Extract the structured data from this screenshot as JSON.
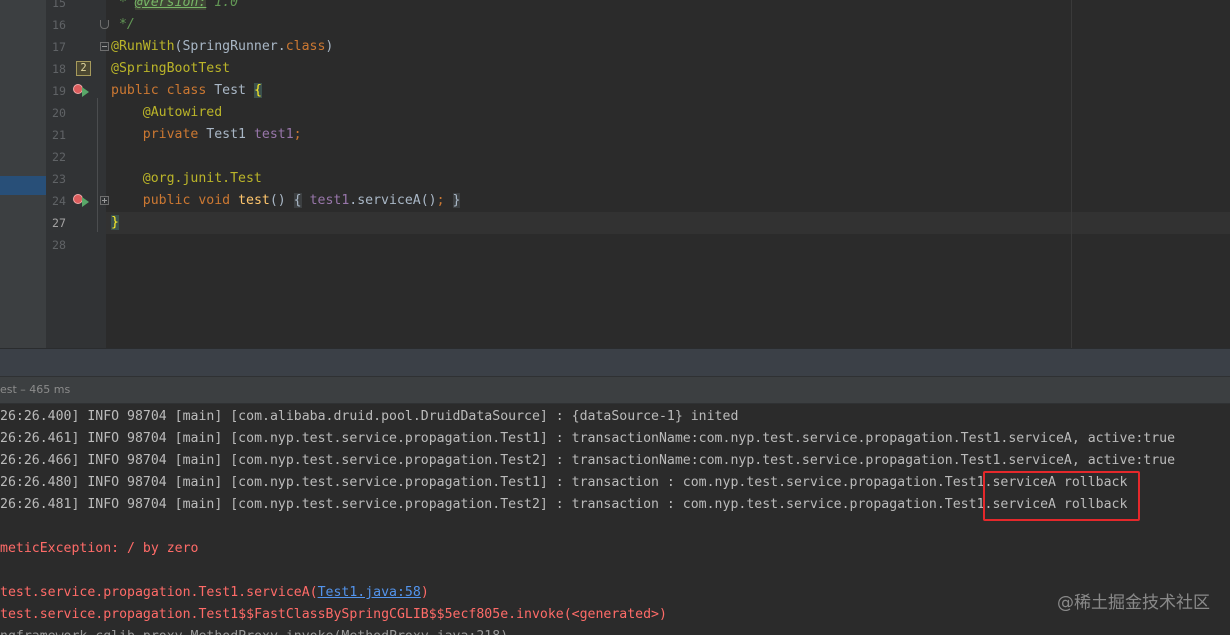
{
  "colors": {
    "editor_bg": "#2b2b2b",
    "keyword": "#cc7832",
    "annotation": "#bbb529",
    "field": "#9876aa",
    "method": "#ffc66d",
    "javadoc": "#629755",
    "console_text": "#bbbbbb",
    "error_text": "#ff6b68",
    "link": "#5394ec",
    "highlight_box": "#e5282b"
  },
  "editor": {
    "line_numbers": [
      "15",
      "16",
      "17",
      "18",
      "19",
      "20",
      "21",
      "22",
      "23",
      "24",
      "27",
      "28"
    ],
    "bookmark_mnemonic": "2",
    "code": {
      "line15": {
        "star": "*",
        "tag": "@version:",
        "value": "1.0"
      },
      "line16": {
        "end": "*/"
      },
      "line17": {
        "annotation": "@RunWith",
        "args": "(SpringRunner.",
        "keyword": "class",
        "close": ")"
      },
      "line18": {
        "annotation": "@SpringBootTest"
      },
      "line19": {
        "keyword": "public class",
        "name": "Test",
        "brace": "{"
      },
      "line20": {
        "annotation": "@Autowired"
      },
      "line21": {
        "keyword": "private",
        "type": "Test1",
        "field": "test1",
        "semi": ";"
      },
      "line23": {
        "annotation": "@org.junit.Test"
      },
      "line24": {
        "keyword": "public void",
        "method": "test",
        "parens": "()",
        "fold_open": "{",
        "field": "test1",
        "call": ".serviceA()",
        "semi": ";",
        "fold_close": "}"
      },
      "line27": {
        "brace": "}"
      }
    }
  },
  "run_panel": {
    "test_label": "est – 465 ms",
    "console": {
      "info_lines": [
        "26:26.400] INFO 98704 [main] [com.alibaba.druid.pool.DruidDataSource] : {dataSource-1} inited",
        "26:26.461] INFO 98704 [main] [com.nyp.test.service.propagation.Test1] : transactionName:com.nyp.test.service.propagation.Test1.serviceA, active:true",
        "26:26.466] INFO 98704 [main] [com.nyp.test.service.propagation.Test2] : transactionName:com.nyp.test.service.propagation.Test1.serviceA, active:true",
        "26:26.480] INFO 98704 [main] [com.nyp.test.service.propagation.Test1] : transaction : com.nyp.test.service.propagation.Test1.serviceA rollback",
        "26:26.481] INFO 98704 [main] [com.nyp.test.service.propagation.Test2] : transaction : com.nyp.test.service.propagation.Test1.serviceA rollback"
      ],
      "exception": "meticException: / by zero",
      "stack_1": {
        "prefix": "test.service.propagation.Test1.serviceA(",
        "link": "Test1.java:58",
        "suffix": ")"
      },
      "stack_2": "test.service.propagation.Test1$$FastClassBySpringCGLIB$$5ecf805e.invoke(<generated>)",
      "stack_3": "ngframework.cglib.proxy.MethodProxy.invoke(MethodProxy.java:218)"
    }
  },
  "watermark": "@稀土掘金技术社区"
}
